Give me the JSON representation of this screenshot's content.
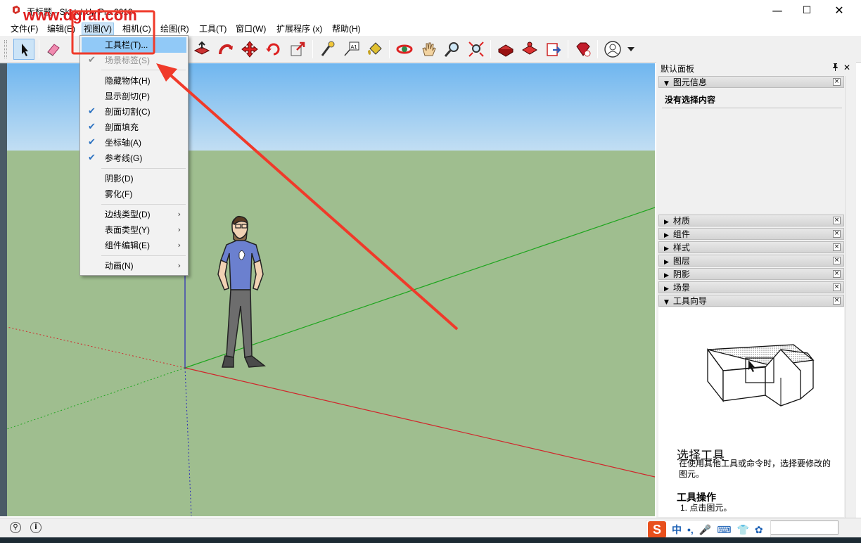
{
  "window": {
    "title": "无标题 - SketchUp Pro 2019",
    "min_glyph": "—",
    "max_glyph": "☐",
    "close_glyph": "✕"
  },
  "watermark": "www.dgrai.com",
  "menubar": [
    {
      "label": "文件(F)"
    },
    {
      "label": "编辑(E)"
    },
    {
      "label": "视图(V)",
      "active": true
    },
    {
      "label": "相机(C)"
    },
    {
      "label": "绘图(R)"
    },
    {
      "label": "工具(T)"
    },
    {
      "label": "窗口(W)"
    },
    {
      "label": "扩展程序 (x)"
    },
    {
      "label": "帮助(H)"
    }
  ],
  "view_menu": {
    "items": [
      {
        "label": "工具栏(T)...",
        "highlight": true,
        "checked": false
      },
      {
        "label": "场景标签(S)",
        "disabled": true,
        "checked": true
      },
      {
        "label": "隐藏物体(H)",
        "checked": false
      },
      {
        "label": "显示剖切(P)",
        "checked": false
      },
      {
        "label": "剖面切割(C)",
        "checked": true
      },
      {
        "label": "剖面填充",
        "checked": true
      },
      {
        "label": "坐标轴(A)",
        "checked": true
      },
      {
        "label": "参考线(G)",
        "checked": true
      },
      {
        "label": "阴影(D)",
        "checked": false
      },
      {
        "label": "雾化(F)",
        "checked": false
      },
      {
        "label": "边线类型(D)",
        "submenu": true
      },
      {
        "label": "表面类型(Y)",
        "submenu": true
      },
      {
        "label": "组件编辑(E)",
        "submenu": true
      },
      {
        "label": "动画(N)",
        "submenu": true
      }
    ],
    "check_glyph": "✔",
    "arrow_glyph": "›"
  },
  "toolbar": {
    "tools": [
      {
        "name": "select-icon"
      },
      {
        "name": "eraser-icon"
      },
      {
        "name": "push-pull-icon"
      },
      {
        "name": "follow-me-icon"
      },
      {
        "name": "move-icon"
      },
      {
        "name": "rotate-icon"
      },
      {
        "name": "scale-icon"
      },
      {
        "name": "tape-measure-icon"
      },
      {
        "name": "text-icon"
      },
      {
        "name": "paint-bucket-icon"
      },
      {
        "name": "orbit-icon"
      },
      {
        "name": "pan-icon"
      },
      {
        "name": "zoom-icon"
      },
      {
        "name": "zoom-extents-icon"
      },
      {
        "name": "warehouse-icon"
      },
      {
        "name": "extension-warehouse-icon"
      },
      {
        "name": "send-to-layout-icon"
      },
      {
        "name": "extension-manager-icon"
      },
      {
        "name": "account-icon"
      }
    ],
    "text_tool_label": "A1"
  },
  "panel": {
    "title": "默认面板",
    "pin_glyph": "📌",
    "close_glyph": "✕",
    "entity_info": {
      "label": "图元信息",
      "empty_text": "没有选择内容"
    },
    "trays": [
      {
        "label": "材质"
      },
      {
        "label": "组件"
      },
      {
        "label": "样式"
      },
      {
        "label": "图层"
      },
      {
        "label": "阴影"
      },
      {
        "label": "场景"
      }
    ],
    "instructor": {
      "label": "工具向导",
      "tool_title": "选择工具",
      "description": "在使用其他工具或命令时，选择要修改的图元。",
      "ops_title": "工具操作",
      "step1": "1. 点击图元。"
    },
    "collapsed_glyph": "▶",
    "expanded_glyph": "▼",
    "tray_close_glyph": "×"
  },
  "statusbar": {
    "geo_icon": "⚲",
    "info_icon": "i"
  },
  "ime": {
    "logo": "S",
    "lang": "中",
    "punct": "•,",
    "mic": "🎤",
    "keyboard": "⌨",
    "shirt": "👕",
    "apps": "✿"
  },
  "colors": {
    "sky_top": "#6fb6ef",
    "ground": "#9fbe8f",
    "axis_red": "#d0262b",
    "axis_green": "#1ea51e",
    "axis_blue": "#2a2ab8",
    "annotation_red": "#f03a2a",
    "menu_highlight": "#91c9f7"
  }
}
